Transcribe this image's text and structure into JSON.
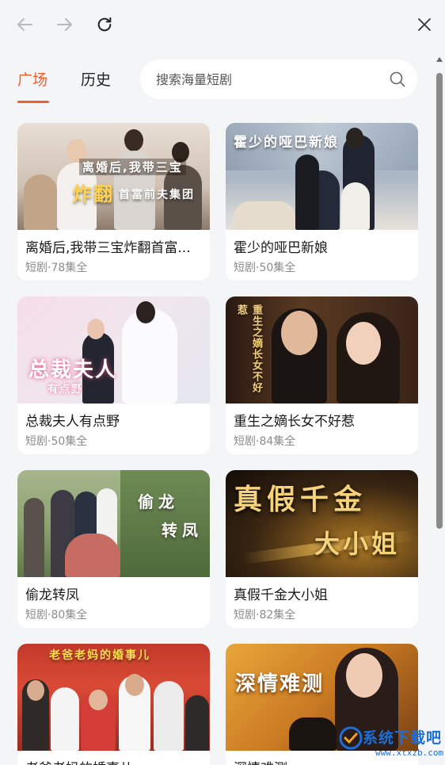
{
  "nav": {
    "back_icon": "arrow-left-icon",
    "forward_icon": "arrow-right-icon",
    "refresh_icon": "refresh-icon",
    "close_icon": "close-icon"
  },
  "tabs": [
    {
      "label": "广场",
      "active": true
    },
    {
      "label": "历史",
      "active": false
    }
  ],
  "search": {
    "placeholder": "搜索海量短剧",
    "icon": "search-icon"
  },
  "cards": [
    {
      "title": "离婚后,我带三宝炸翻首富...",
      "meta": "短剧·78集全",
      "poster_text": [
        "离婚后,我带三宝",
        "炸翻",
        "首富前夫集团"
      ]
    },
    {
      "title": "霍少的哑巴新娘",
      "meta": "短剧·50集全",
      "poster_text": [
        "霍少的哑巴新娘"
      ]
    },
    {
      "title": "总裁夫人有点野",
      "meta": "短剧·50集全",
      "poster_text": [
        "总裁夫人",
        "有点野"
      ]
    },
    {
      "title": "重生之嫡长女不好惹",
      "meta": "短剧·84集全",
      "poster_text": [
        "重生之嫡长女不好惹"
      ]
    },
    {
      "title": "偷龙转凤",
      "meta": "短剧·80集全",
      "poster_text": [
        "偷龙",
        "转凤"
      ]
    },
    {
      "title": "真假千金大小姐",
      "meta": "短剧·82集全",
      "poster_text": [
        "真假千金",
        "大小姐"
      ]
    },
    {
      "title": "老爸老妈的婚事儿",
      "meta": "",
      "poster_text": [
        "老爸老妈的婚事儿"
      ]
    },
    {
      "title": "深情难测",
      "meta": "",
      "poster_text": [
        "深情难测"
      ]
    }
  ],
  "watermark": {
    "text": "系统下载吧",
    "url": "www.xtxzb.com"
  },
  "colors": {
    "accent": "#f0602c",
    "background": "#f4f5f7",
    "card": "#ffffff",
    "meta": "#8c8c8c"
  }
}
